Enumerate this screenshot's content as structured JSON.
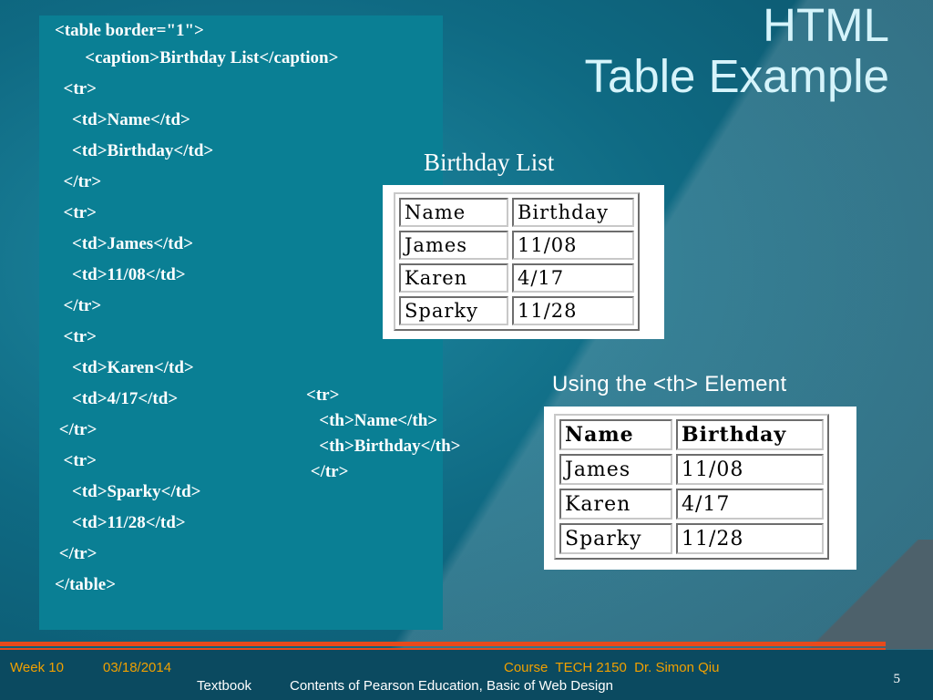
{
  "slide": {
    "title_line1": "HTML",
    "title_line2": "Table Example",
    "page_number": "5"
  },
  "code": {
    "lines": [
      "<table border=\"1\">",
      "       <caption>Birthday List</caption>",
      "  <tr>",
      "    <td>Name</td>",
      "    <td>Birthday</td>",
      "  </tr>",
      "  <tr>",
      "    <td>James</td>",
      "    <td>11/08</td>",
      "  </tr>",
      "  <tr>",
      "    <td>Karen</td>",
      "    <td>4/17</td>",
      " </tr>",
      "  <tr>",
      "    <td>Sparky</td>",
      "    <td>11/28</td>",
      " </tr>",
      "</table>"
    ],
    "th_lines": [
      "<tr>",
      "   <th>Name</th>",
      "   <th>Birthday</th>",
      " </tr>"
    ]
  },
  "example1": {
    "caption": "Birthday List",
    "rows": [
      [
        "Name",
        "Birthday"
      ],
      [
        "James",
        "11/08"
      ],
      [
        "Karen",
        "4/17"
      ],
      [
        "Sparky",
        "11/28"
      ]
    ]
  },
  "example2": {
    "label": "Using the <th> Element",
    "header": [
      "Name",
      "Birthday"
    ],
    "rows": [
      [
        "James",
        "11/08"
      ],
      [
        "Karen",
        "4/17"
      ],
      [
        "Sparky",
        "11/28"
      ]
    ]
  },
  "footer": {
    "week": "Week 10",
    "date": "03/18/2014",
    "course": "Course  TECH 2150  Dr. Simon Qiu",
    "textbook_label": "Textbook",
    "textbook_value": "Contents of Pearson Education, Basic of Web Design"
  },
  "colors": {
    "background": "#0d5870",
    "code_panel": "#0a7f94",
    "title": "#d6f4fb",
    "accent_rule": "#e84a1c",
    "footer_text": "#f0a000"
  }
}
